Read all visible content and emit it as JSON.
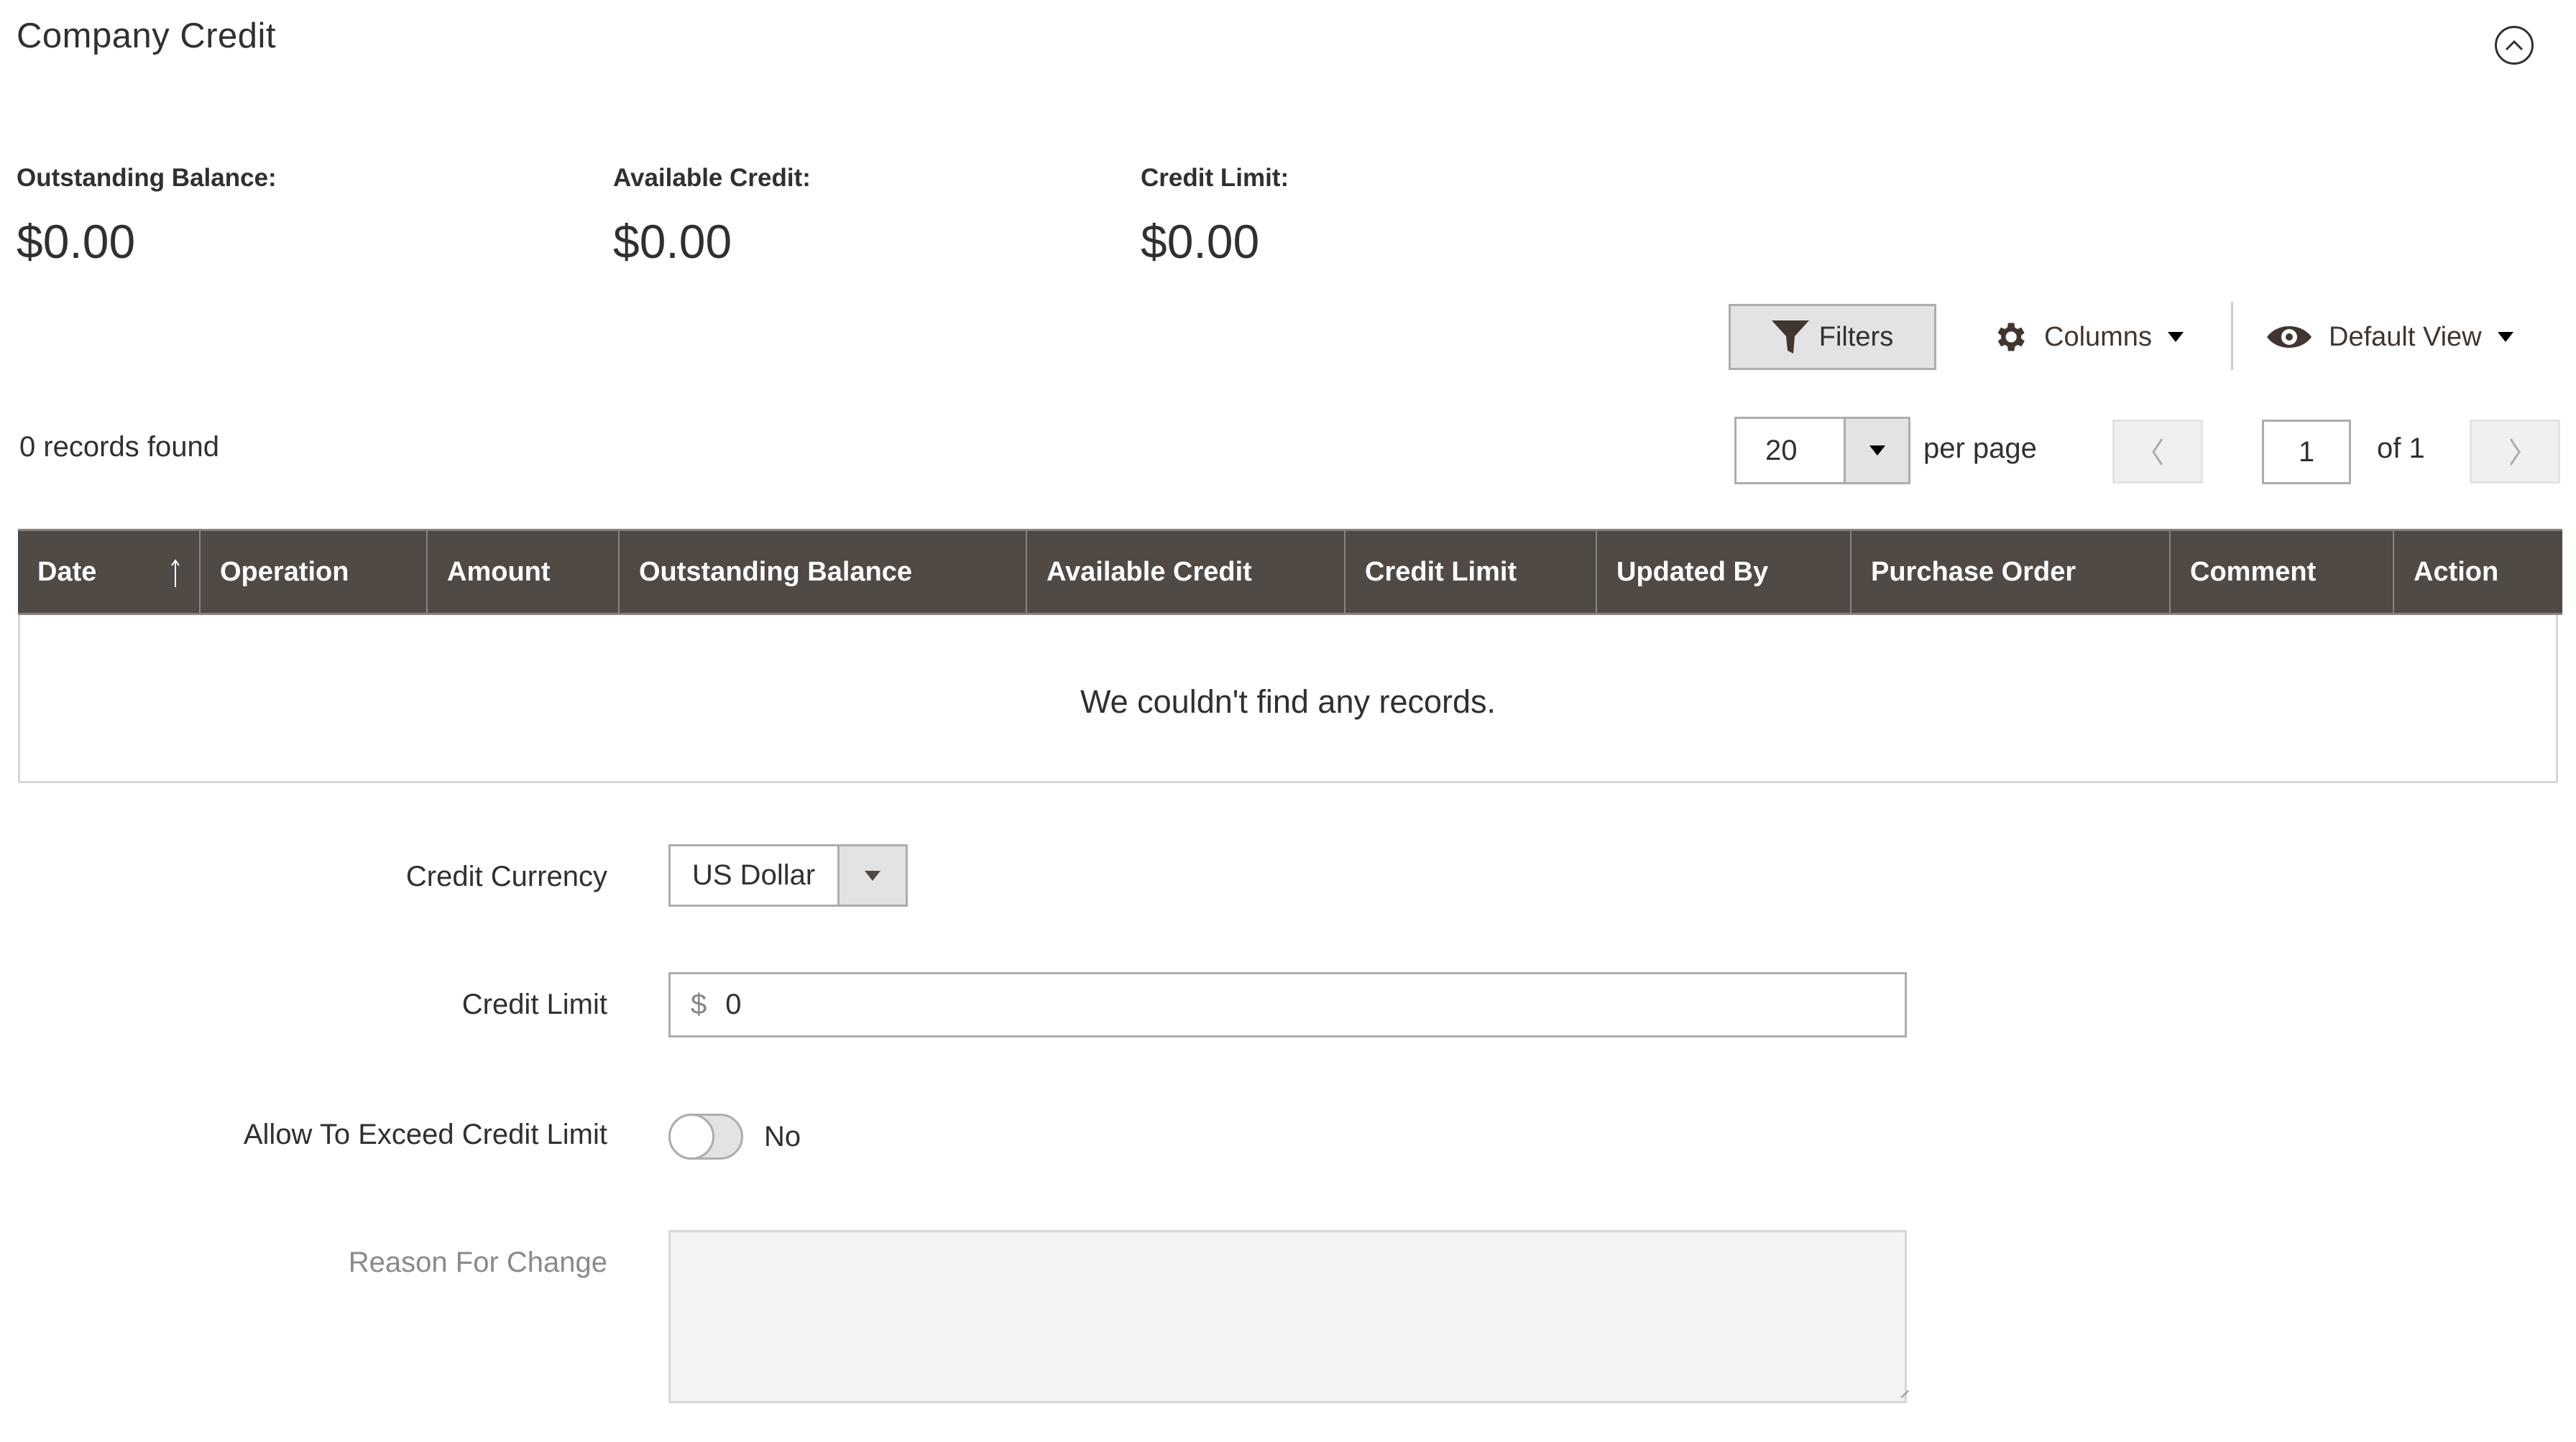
{
  "section": {
    "title": "Company Credit",
    "collapse_icon": "chevron-up-circle-icon"
  },
  "summary": [
    {
      "label": "Outstanding Balance:",
      "value": "$0.00"
    },
    {
      "label": "Available Credit:",
      "value": "$0.00"
    },
    {
      "label": "Credit Limit:",
      "value": "$0.00"
    }
  ],
  "toolbar": {
    "filters_label": "Filters",
    "filters_icon": "funnel-icon",
    "columns_label": "Columns",
    "columns_icon": "gear-icon",
    "view_label": "Default View",
    "view_icon": "eye-icon"
  },
  "grid": {
    "records_found": "0 records found",
    "per_page_value": "20",
    "per_page_label": "per page",
    "current_page": "1",
    "total_pages_label": "of 1",
    "columns": [
      {
        "label": "Date",
        "sorted": "ascending"
      },
      {
        "label": "Operation"
      },
      {
        "label": "Amount"
      },
      {
        "label": "Outstanding Balance"
      },
      {
        "label": "Available Credit"
      },
      {
        "label": "Credit Limit"
      },
      {
        "label": "Updated By"
      },
      {
        "label": "Purchase Order"
      },
      {
        "label": "Comment"
      },
      {
        "label": "Action"
      }
    ],
    "empty_message": "We couldn't find any records."
  },
  "form": {
    "credit_currency": {
      "label": "Credit Currency",
      "value": "US Dollar"
    },
    "credit_limit": {
      "label": "Credit Limit",
      "prefix": "$",
      "value": "0"
    },
    "allow_exceed": {
      "label": "Allow To Exceed Credit Limit",
      "state": "No"
    },
    "reason": {
      "label": "Reason For Change",
      "value": ""
    }
  },
  "colors": {
    "header_bg": "#514943",
    "text": "#303030",
    "button_bg": "#e3e3e3",
    "border": "#adadad"
  }
}
